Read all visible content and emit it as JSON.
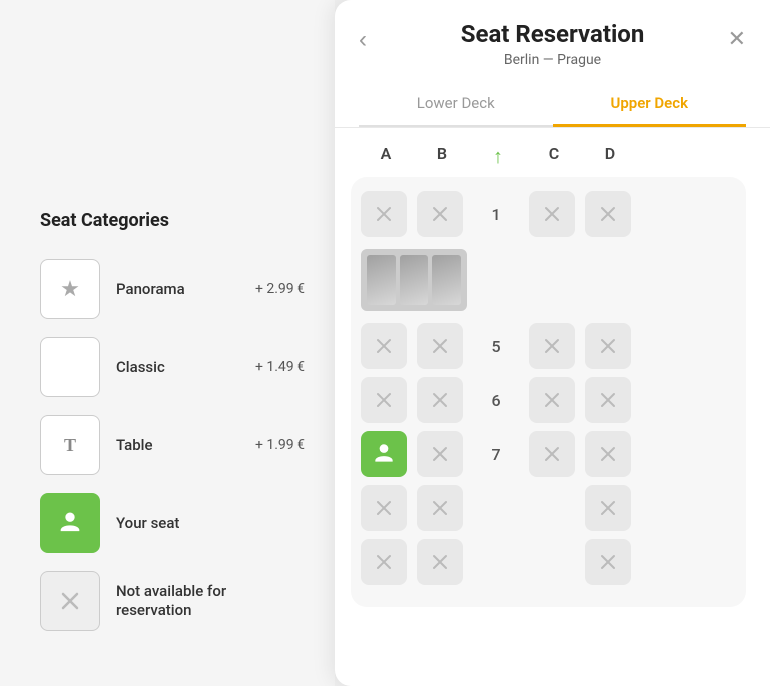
{
  "app": {
    "title": "Seat Reservation",
    "subtitle": "Berlin — Prague"
  },
  "tabs": [
    {
      "id": "lower",
      "label": "Lower Deck",
      "active": false
    },
    {
      "id": "upper",
      "label": "Upper Deck",
      "active": true
    }
  ],
  "columns": [
    "A",
    "B",
    "",
    "C",
    "D"
  ],
  "direction_icon": "↑",
  "categories": [
    {
      "id": "panorama",
      "icon": "★",
      "label": "Panorama",
      "price": "+ 2.99 €",
      "type": "star"
    },
    {
      "id": "classic",
      "icon": "",
      "label": "Classic",
      "price": "+ 1.49 €",
      "type": "square"
    },
    {
      "id": "table",
      "icon": "T",
      "label": "Table",
      "price": "+ 1.99 €",
      "type": "table"
    },
    {
      "id": "your-seat",
      "icon": "person",
      "label": "Your seat",
      "price": "",
      "type": "green"
    },
    {
      "id": "unavailable",
      "icon": "x",
      "label": "Not available for reservation",
      "price": "",
      "type": "unavailable"
    }
  ],
  "seat_categories_title": "Seat Categories",
  "nav": {
    "back": "‹",
    "close": "✕"
  },
  "rows": [
    {
      "num": "1",
      "seats": [
        "unavailable",
        "unavailable",
        "unavailable",
        "unavailable"
      ]
    },
    {
      "num": "",
      "seats": [
        "panorama",
        "panorama",
        null,
        null
      ]
    },
    {
      "num": "5",
      "seats": [
        "unavailable",
        "unavailable",
        "unavailable",
        "unavailable"
      ]
    },
    {
      "num": "6",
      "seats": [
        "unavailable",
        "unavailable",
        "unavailable",
        "unavailable"
      ]
    },
    {
      "num": "7",
      "seats": [
        "selected",
        "unavailable",
        "unavailable",
        "unavailable"
      ]
    },
    {
      "num": "",
      "seats": [
        "unavailable",
        "unavailable",
        null,
        "unavailable"
      ]
    },
    {
      "num": "",
      "seats": [
        "unavailable",
        "unavailable",
        null,
        "unavailable"
      ]
    }
  ]
}
